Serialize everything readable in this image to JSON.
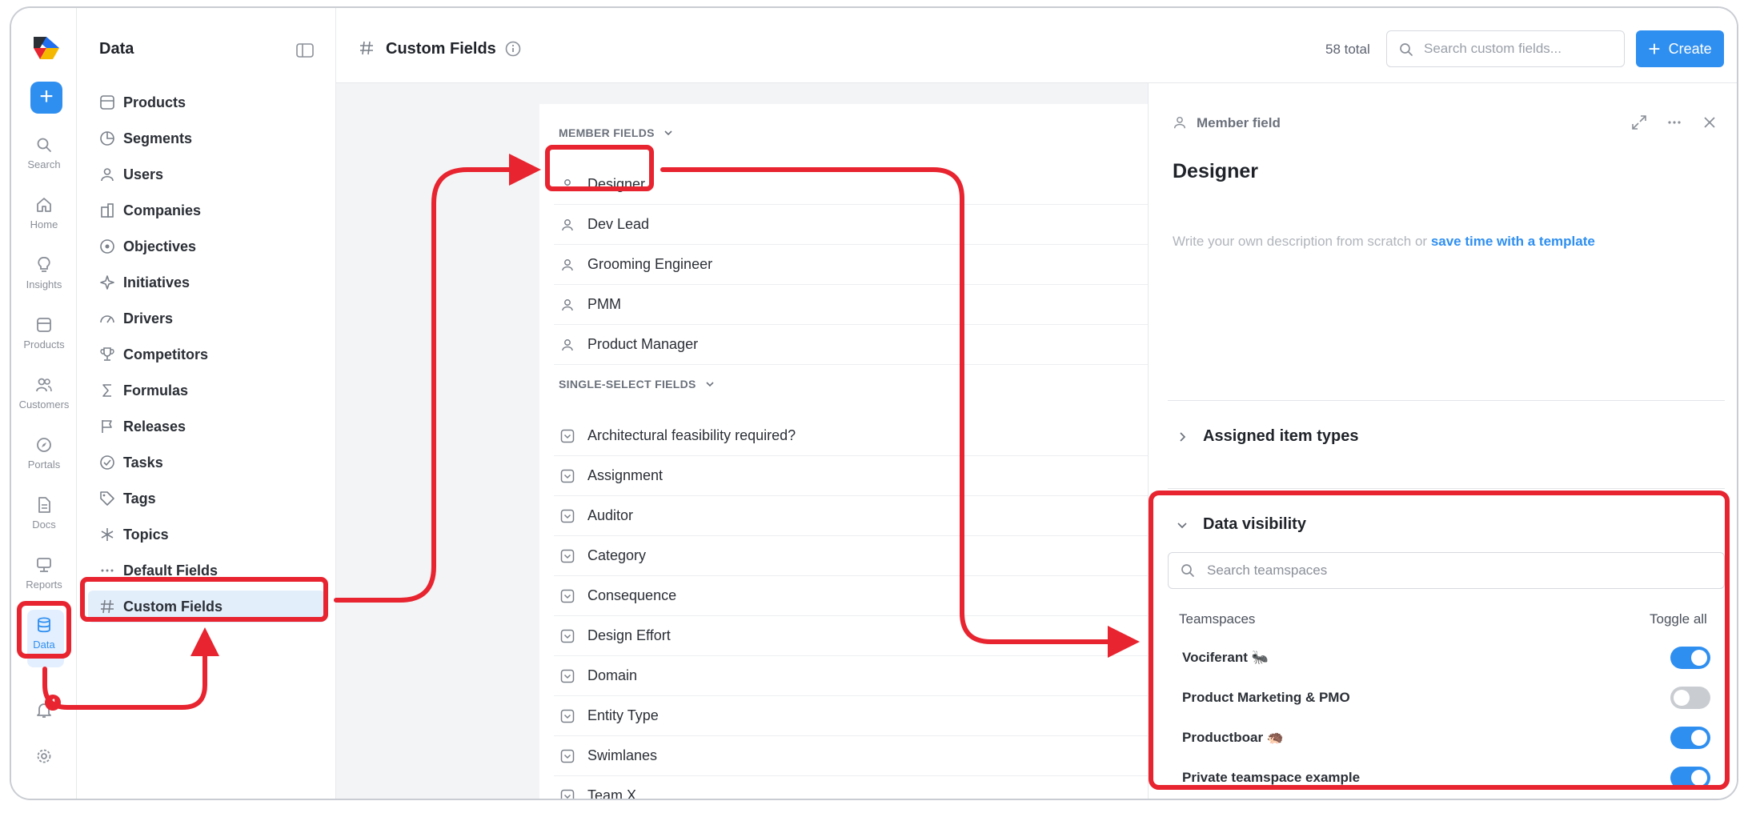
{
  "rail": {
    "items": [
      {
        "label": "Search",
        "icon": "search-icon"
      },
      {
        "label": "Home",
        "icon": "home-icon"
      },
      {
        "label": "Insights",
        "icon": "lightbulb-icon"
      },
      {
        "label": "Products",
        "icon": "products-icon"
      },
      {
        "label": "Customers",
        "icon": "users-icon"
      },
      {
        "label": "Portals",
        "icon": "compass-icon"
      },
      {
        "label": "Docs",
        "icon": "doc-icon"
      },
      {
        "label": "Reports",
        "icon": "presentation-icon"
      },
      {
        "label": "Data",
        "icon": "database-icon"
      }
    ],
    "notification_count": "4"
  },
  "sidebar": {
    "title": "Data",
    "items": [
      {
        "label": "Products"
      },
      {
        "label": "Segments"
      },
      {
        "label": "Users"
      },
      {
        "label": "Companies"
      },
      {
        "label": "Objectives"
      },
      {
        "label": "Initiatives"
      },
      {
        "label": "Drivers"
      },
      {
        "label": "Competitors"
      },
      {
        "label": "Formulas"
      },
      {
        "label": "Releases"
      },
      {
        "label": "Tasks"
      },
      {
        "label": "Tags"
      },
      {
        "label": "Topics"
      },
      {
        "label": "Default Fields"
      },
      {
        "label": "Custom Fields"
      }
    ]
  },
  "topbar": {
    "title": "Custom Fields",
    "total": "58 total",
    "search_placeholder": "Search custom fields...",
    "create_label": "Create"
  },
  "list": {
    "member_header": "MEMBER FIELDS",
    "member_fields": [
      "Designer",
      "Dev Lead",
      "Grooming Engineer",
      "PMM",
      "Product Manager"
    ],
    "single_header": "SINGLE-SELECT FIELDS",
    "single_fields": [
      "Architectural feasibility required?",
      "Assignment",
      "Auditor",
      "Category",
      "Consequence",
      "Design Effort",
      "Domain",
      "Entity Type",
      "Swimlanes",
      "Team X"
    ]
  },
  "panel": {
    "kind": "Member field",
    "title": "Designer",
    "desc_prefix": "Write your own description from scratch or",
    "desc_link": "save time with a template",
    "assigned_label": "Assigned item types",
    "visibility_label": "Data visibility",
    "teamspace_search_placeholder": "Search teamspaces",
    "teamspaces_header": "Teamspaces",
    "toggle_all": "Toggle all",
    "teamspaces": [
      {
        "name": "Vociferant 🐜",
        "on": true
      },
      {
        "name": "Product Marketing & PMO",
        "on": false
      },
      {
        "name": "Productboar 🦔",
        "on": true
      },
      {
        "name": "Private teamspace example",
        "on": true
      }
    ]
  },
  "colors": {
    "accent": "#2f8ff0",
    "annotation": "#e7242f",
    "active_bg": "#e3eefb"
  }
}
